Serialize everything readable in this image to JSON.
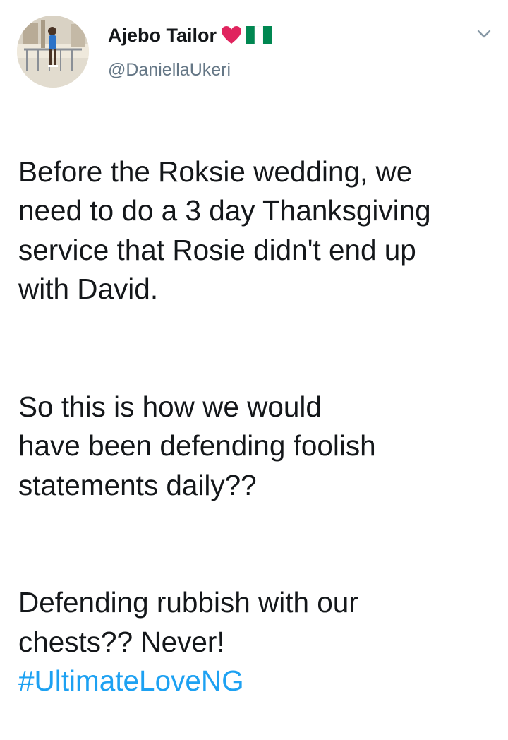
{
  "tweet": {
    "author": {
      "display_name": "Ajebo Tailor",
      "handle": "@DaniellaUkeri",
      "name_emojis": [
        "red-heart-emoji",
        "nigeria-flag-emoji"
      ]
    },
    "paragraphs": [
      "Before the Roksie wedding, we\nneed to do a 3 day Thanksgiving\nservice that Rosie didn't end up\nwith David.",
      "So this is how we would\nhave been defending foolish\nstatements daily??",
      "Defending rubbish with our\nchests?? Never!"
    ],
    "hashtag": "#UltimateLoveNG"
  },
  "icons": {
    "more_options": "chevron-down-icon"
  },
  "colors": {
    "text": "#14171a",
    "secondary": "#657786",
    "link": "#1da1f2",
    "heart": "#e0245e",
    "flag_green": "#008751"
  }
}
